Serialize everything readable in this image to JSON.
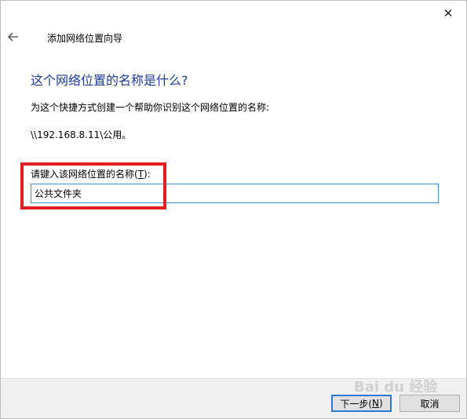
{
  "window": {
    "close_glyph": "✕"
  },
  "header": {
    "title": "添加网络位置向导"
  },
  "main": {
    "heading": "这个网络位置的名称是什么?",
    "description": "为这个快捷方式创建一个帮助你识别这个网络位置的名称:",
    "unc_path": "\\\\192.168.8.11\\公用。",
    "name_label_prefix": "请键入该网络位置的名称(",
    "name_label_accel": "T",
    "name_label_suffix": "):",
    "name_value": "公共文件夹"
  },
  "footer": {
    "next_prefix": "下一步(",
    "next_accel": "N",
    "next_suffix": ")",
    "cancel_label": "取消"
  },
  "watermark": {
    "text": "Bai du 经验"
  },
  "colors": {
    "heading": "#1f3e99",
    "highlight": "#e01e24",
    "input_border": "#3f8fd4",
    "default_button_border": "#2b78d6"
  }
}
